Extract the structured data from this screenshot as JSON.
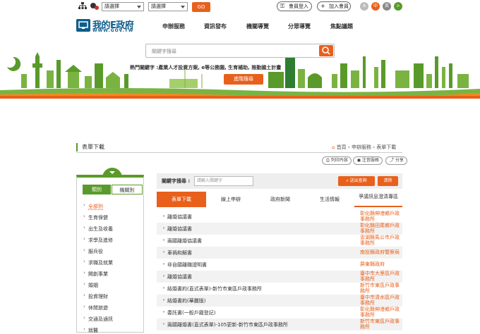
{
  "topbar": {
    "select1": "請選擇",
    "select2": "請選擇",
    "go": "GO",
    "login": "會員登入",
    "join": "加入會員",
    "lang": [
      "A",
      "中",
      "英",
      ">"
    ],
    "colors": {
      "accent": "#e8601c",
      "brand": "#0e5d8a",
      "green": "#5a9a2a"
    }
  },
  "logo": {
    "title": "我的E政府",
    "url_text": "WWW.GOV.TW"
  },
  "nav": [
    "申辦服務",
    "資訊發布",
    "機關導覽",
    "分眾導覽",
    "焦點議題"
  ],
  "hero": {
    "search_placeholder": "關鍵字搜尋",
    "hot_keywords": "熱門關鍵字 :產業人才投資方案, e等公務園, 生育補助, 推動國土計畫",
    "advanced": "進階搜尋"
  },
  "page": {
    "title": "表單下載",
    "breadcrumb": [
      "首頁",
      "申辦服務",
      "表單下載"
    ],
    "print": "列印內容",
    "rss": "注音服務",
    "share": "分享"
  },
  "sidebar": {
    "tabs": [
      "類別",
      "機關別"
    ],
    "items": [
      "全部別",
      "生育保健",
      "出生及收養",
      "求學及進修",
      "服兵役",
      "求職及就業",
      "開創事業",
      "婚姻",
      "投資理財",
      "休閒旅遊",
      "交通及通訊",
      "就醫"
    ]
  },
  "filter": {
    "label": "關鍵字搜尋 :",
    "placeholder": "請輸入關鍵字",
    "submit": "送出查詢",
    "clear": "清除"
  },
  "tabs": [
    "表單下載",
    "線上申辦",
    "政府新聞",
    "生活情報",
    "爭議訊息澄清專區"
  ],
  "rows": [
    {
      "title": "離婚協議書",
      "org": "彰化縣伸港鄉戶政事務所"
    },
    {
      "title": "離婚協議書",
      "org": "彰化縣田尾鄉戶政事務所"
    },
    {
      "title": "兩願離婚協議書",
      "org": "澎湖縣馬公市戶政事務所"
    },
    {
      "title": "車禍和解書",
      "org": "南投縣政府警察局"
    },
    {
      "title": "非自願離職證明書",
      "org": "屏東縣政府"
    },
    {
      "title": "離婚協議書",
      "org": "臺中市大里區戶政事務所"
    },
    {
      "title": "結婚書約(直式表單)-新竹市東區戶政事務所",
      "org": "新竹市東區戶政事務所"
    },
    {
      "title": "結婚書約(華麗版)",
      "org": "臺中市清水區戶政事務所"
    },
    {
      "title": "委託書(一般戶籍登記)",
      "org": "彰化縣伸港鄉戶政事務所"
    },
    {
      "title": "兩願離婚書(直式表單)-105更新-新竹市東區戶政事務所",
      "org": "新竹市東區戶政事務所"
    }
  ]
}
